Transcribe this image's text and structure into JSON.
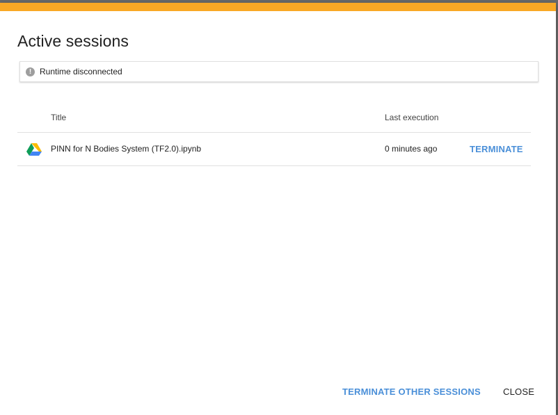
{
  "dialog": {
    "title": "Active sessions",
    "accent_color": "#f9a825"
  },
  "status": {
    "icon": "info-icon",
    "text": "Runtime disconnected"
  },
  "table": {
    "headers": {
      "title": "Title",
      "last_execution": "Last execution"
    },
    "rows": [
      {
        "icon": "google-drive-icon",
        "title": "PINN for N Bodies System (TF2.0).ipynb",
        "last_execution": "0 minutes ago",
        "action": "TERMINATE"
      }
    ]
  },
  "footer": {
    "terminate_other_label": "TERMINATE OTHER SESSIONS",
    "close_label": "CLOSE"
  },
  "colors": {
    "link_blue": "#4a8fd8"
  }
}
